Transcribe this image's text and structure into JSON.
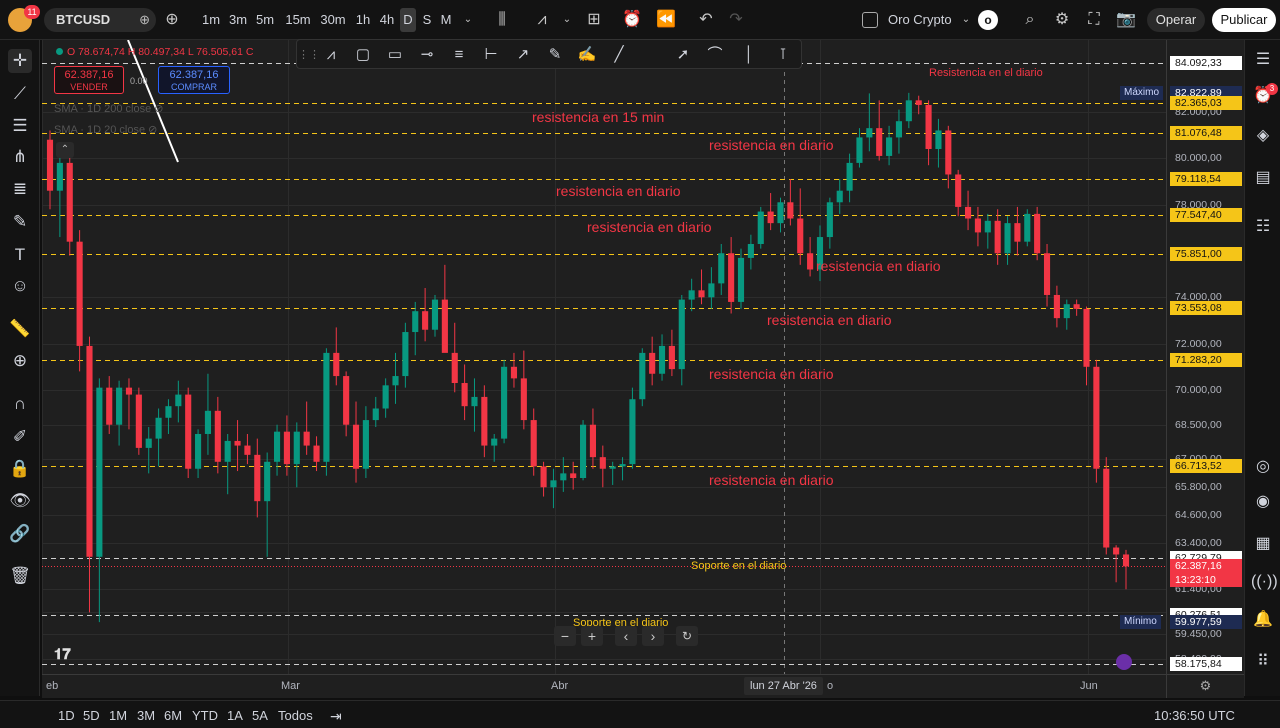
{
  "topbar": {
    "symbol": "BTCUSD",
    "notif_badge": "11",
    "intervals": [
      "1m",
      "3m",
      "5m",
      "15m",
      "30m",
      "1h",
      "4h",
      "D",
      "S",
      "M"
    ],
    "active_interval": "D",
    "watchlist": "Oro Crypto",
    "avatar_letter": "o",
    "trade_label": "Operar",
    "publish_label": "Publicar"
  },
  "legend": {
    "ohlc_text": "O 78.674,74 H 80.497,34 L 76.505,61 C",
    "sell_price": "62.387,16",
    "sell_label": "VENDER",
    "spread": "0.00",
    "buy_price": "62.387,16",
    "buy_label": "COMPRAR",
    "indicators": [
      "SMA · 1D 200 close",
      "SMA · 1D 20 close"
    ]
  },
  "price_scale": {
    "ticks": [
      {
        "text": "82.000,00",
        "price": 82000
      },
      {
        "text": "80.000,00",
        "price": 80000
      },
      {
        "text": "78.000,00",
        "price": 78000
      },
      {
        "text": "74.000,00",
        "price": 74000
      },
      {
        "text": "72.000,00",
        "price": 72000
      },
      {
        "text": "70.000,00",
        "price": 70000
      },
      {
        "text": "68.500,00",
        "price": 68500
      },
      {
        "text": "67.000,00",
        "price": 67000
      },
      {
        "text": "65.800,00",
        "price": 65800
      },
      {
        "text": "64.600,00",
        "price": 64600
      },
      {
        "text": "63.400,00",
        "price": 63400
      },
      {
        "text": "61.400,00",
        "price": 61400
      },
      {
        "text": "60.400,00",
        "price": 60400
      },
      {
        "text": "59.450,00",
        "price": 59450
      },
      {
        "text": "58.400,00",
        "price": 58400
      }
    ],
    "level_labels": [
      {
        "text": "84.092,33",
        "price": 84092.33,
        "bg": "#ffffff",
        "fg": "#131313"
      },
      {
        "text": "82.822,89",
        "price": 82822.89,
        "bg": "#1e2b52",
        "fg": "#ffffff",
        "tag": "Máximo"
      },
      {
        "text": "82.365,03",
        "price": 82365.03,
        "bg": "#f5c518",
        "fg": "#131313"
      },
      {
        "text": "81.076,48",
        "price": 81076.48,
        "bg": "#f5c518",
        "fg": "#131313"
      },
      {
        "text": "79.118,54",
        "price": 79118.54,
        "bg": "#f5c518",
        "fg": "#131313"
      },
      {
        "text": "77.547,40",
        "price": 77547.4,
        "bg": "#f5c518",
        "fg": "#131313"
      },
      {
        "text": "75.851,00",
        "price": 75851.0,
        "bg": "#f5c518",
        "fg": "#131313"
      },
      {
        "text": "73.553,08",
        "price": 73553.08,
        "bg": "#f5c518",
        "fg": "#131313"
      },
      {
        "text": "71.283,20",
        "price": 71283.2,
        "bg": "#f5c518",
        "fg": "#131313"
      },
      {
        "text": "66.713,52",
        "price": 66713.52,
        "bg": "#f5c518",
        "fg": "#131313"
      },
      {
        "text": "62.729,79",
        "price": 62729.79,
        "bg": "#ffffff",
        "fg": "#131313"
      },
      {
        "text": "62.387,16",
        "price": 62387.16,
        "bg": "#f23645",
        "fg": "#ffffff",
        "sub": "13:23:10"
      },
      {
        "text": "60.276,51",
        "price": 60276.51,
        "bg": "#ffffff",
        "fg": "#131313"
      },
      {
        "text": "59.977,59",
        "price": 59977.59,
        "bg": "#1e2b52",
        "fg": "#ffffff",
        "tag": "Mínimo"
      },
      {
        "text": "58.175,84",
        "price": 58175.84,
        "bg": "#ffffff",
        "fg": "#131313"
      }
    ]
  },
  "annotations": [
    {
      "text": "Resistencia en el diario",
      "kind": "red-small",
      "price": 84092.33,
      "at": "right"
    },
    {
      "text": "resistencia en 15 min",
      "kind": "red",
      "price": 82365.03,
      "at": "left"
    },
    {
      "text": "resistencia en diario",
      "kind": "red",
      "price": 81076.48,
      "at": "mid1"
    },
    {
      "text": "resistencia en diario",
      "kind": "red",
      "price": 79118.54,
      "at": "left2"
    },
    {
      "text": "resistencia en diario",
      "kind": "red",
      "price": 77547.4,
      "at": "left3"
    },
    {
      "text": "resistencia en diario",
      "kind": "red",
      "price": 75851.0,
      "at": "mid2"
    },
    {
      "text": "resistencia en diario",
      "kind": "red",
      "price": 73553.08,
      "at": "mid3"
    },
    {
      "text": "resistencia en diario",
      "kind": "red",
      "price": 71283.2,
      "at": "mid4"
    },
    {
      "text": "resistencia en diario",
      "kind": "red",
      "price": 66713.52,
      "at": "mid4"
    },
    {
      "text": "Soporte en el diario",
      "kind": "yellow",
      "price": 62729.79,
      "at": "mid5"
    },
    {
      "text": "Soporte en el diario",
      "kind": "yellow",
      "price": 60276.51,
      "at": "mid6"
    }
  ],
  "time_scale": {
    "labels": [
      "eb",
      "Mar",
      "Abr",
      "o",
      "Jun"
    ],
    "crosshair_label": "lun 27 Abr '26"
  },
  "colors": {
    "up": "#089981",
    "down": "#f23645",
    "level": "#f5c518",
    "red_text": "#f23645",
    "yellow_text": "#f5c518"
  },
  "chart_data": {
    "type": "candlestick",
    "symbol": "BTCUSD",
    "interval": "1D",
    "ylim": [
      58000,
      84500
    ],
    "candles": [
      [
        80800,
        81200,
        77800,
        78600
      ],
      [
        78600,
        80200,
        76600,
        79800
      ],
      [
        79800,
        80500,
        75800,
        76400
      ],
      [
        76400,
        76900,
        70800,
        71900
      ],
      [
        71900,
        72300,
        60400,
        62800
      ],
      [
        62800,
        70500,
        59977.59,
        70100
      ],
      [
        70100,
        70600,
        68100,
        68500
      ],
      [
        68500,
        70400,
        67600,
        70100
      ],
      [
        70100,
        70500,
        68300,
        69800
      ],
      [
        69800,
        70100,
        67200,
        67500
      ],
      [
        67500,
        68400,
        66400,
        67900
      ],
      [
        67900,
        69200,
        66700,
        68800
      ],
      [
        68800,
        69600,
        68100,
        69300
      ],
      [
        69300,
        70400,
        68600,
        69800
      ],
      [
        69800,
        70100,
        66200,
        66600
      ],
      [
        66600,
        68300,
        66200,
        68100
      ],
      [
        68100,
        70700,
        67200,
        69100
      ],
      [
        69100,
        69700,
        66400,
        66900
      ],
      [
        66900,
        68100,
        65500,
        67800
      ],
      [
        67800,
        68700,
        66500,
        67600
      ],
      [
        67600,
        68100,
        66800,
        67200
      ],
      [
        67200,
        67900,
        64500,
        65200
      ],
      [
        65200,
        67300,
        62800,
        66900
      ],
      [
        66900,
        68500,
        66300,
        68200
      ],
      [
        68200,
        68900,
        66300,
        66800
      ],
      [
        66800,
        68600,
        65800,
        68200
      ],
      [
        68200,
        69500,
        67200,
        67600
      ],
      [
        67600,
        68000,
        66500,
        66900
      ],
      [
        66900,
        71800,
        66300,
        71600
      ],
      [
        71600,
        72700,
        70200,
        70600
      ],
      [
        70600,
        70800,
        68000,
        68500
      ],
      [
        68500,
        69500,
        66000,
        66600
      ],
      [
        66600,
        69300,
        66200,
        68700
      ],
      [
        68700,
        69700,
        68400,
        69200
      ],
      [
        69200,
        70500,
        68800,
        70200
      ],
      [
        70200,
        71600,
        69400,
        70600
      ],
      [
        70600,
        72900,
        70100,
        72500
      ],
      [
        72500,
        73800,
        71500,
        73400
      ],
      [
        73400,
        74400,
        72100,
        72600
      ],
      [
        72600,
        74100,
        72300,
        73900
      ],
      [
        73900,
        75400,
        73700,
        71600
      ],
      [
        71600,
        72900,
        69900,
        70300
      ],
      [
        70300,
        71100,
        68700,
        69300
      ],
      [
        69300,
        70500,
        68200,
        69700
      ],
      [
        69700,
        70200,
        67100,
        67600
      ],
      [
        67600,
        68100,
        66900,
        67900
      ],
      [
        67900,
        71300,
        67700,
        71000
      ],
      [
        71000,
        71600,
        70100,
        70500
      ],
      [
        70500,
        71700,
        68300,
        68700
      ],
      [
        68700,
        69200,
        66300,
        66700
      ],
      [
        66700,
        66900,
        65400,
        65800
      ],
      [
        65800,
        66600,
        64900,
        66100
      ],
      [
        66100,
        67100,
        65600,
        66400
      ],
      [
        66400,
        66900,
        65700,
        66200
      ],
      [
        66200,
        68700,
        66100,
        68500
      ],
      [
        68500,
        69200,
        66600,
        67100
      ],
      [
        67100,
        67600,
        65800,
        66600
      ],
      [
        66600,
        66900,
        65900,
        66700
      ],
      [
        66700,
        67100,
        66100,
        66800
      ],
      [
        66800,
        70100,
        66600,
        69600
      ],
      [
        69600,
        71800,
        69300,
        71600
      ],
      [
        71600,
        72300,
        70200,
        70700
      ],
      [
        70700,
        72400,
        70400,
        71900
      ],
      [
        71900,
        72600,
        70600,
        70900
      ],
      [
        70900,
        74100,
        70200,
        73900
      ],
      [
        73900,
        74800,
        73400,
        74300
      ],
      [
        74300,
        75200,
        73700,
        74000
      ],
      [
        74000,
        75300,
        73500,
        74600
      ],
      [
        74600,
        76300,
        74100,
        75900
      ],
      [
        75900,
        76600,
        73300,
        73800
      ],
      [
        73800,
        76100,
        73500,
        75700
      ],
      [
        75700,
        76700,
        75200,
        76300
      ],
      [
        76300,
        77900,
        76100,
        77700
      ],
      [
        77700,
        78500,
        76900,
        77200
      ],
      [
        77200,
        78300,
        76800,
        78100
      ],
      [
        78100,
        79100,
        77100,
        77400
      ],
      [
        77400,
        78700,
        75400,
        75900
      ],
      [
        75900,
        76600,
        74900,
        75200
      ],
      [
        75200,
        77100,
        74700,
        76600
      ],
      [
        76600,
        78300,
        76100,
        78100
      ],
      [
        78100,
        79100,
        77600,
        78600
      ],
      [
        78600,
        80200,
        78100,
        79800
      ],
      [
        79800,
        81300,
        79600,
        80900
      ],
      [
        80900,
        82800,
        80300,
        81300
      ],
      [
        81300,
        82500,
        79900,
        80100
      ],
      [
        80100,
        81400,
        79700,
        80900
      ],
      [
        80900,
        82100,
        80200,
        81600
      ],
      [
        81600,
        82822.89,
        81300,
        82500
      ],
      [
        82500,
        82700,
        81900,
        82300
      ],
      [
        82300,
        82500,
        79700,
        80400
      ],
      [
        80400,
        81700,
        79600,
        81200
      ],
      [
        81200,
        81400,
        78700,
        79300
      ],
      [
        79300,
        79500,
        77500,
        77900
      ],
      [
        77900,
        78600,
        76900,
        77400
      ],
      [
        77400,
        77900,
        76200,
        76800
      ],
      [
        76800,
        77600,
        76100,
        77300
      ],
      [
        77300,
        77800,
        75400,
        75900
      ],
      [
        75900,
        77500,
        75400,
        77200
      ],
      [
        77200,
        77900,
        75800,
        76400
      ],
      [
        76400,
        77800,
        76200,
        77600
      ],
      [
        77600,
        77900,
        75600,
        75900
      ],
      [
        75900,
        76300,
        73600,
        74100
      ],
      [
        74100,
        74500,
        72700,
        73100
      ],
      [
        73100,
        73900,
        72600,
        73700
      ],
      [
        73700,
        73900,
        73200,
        73500
      ],
      [
        73500,
        73600,
        70200,
        71000
      ],
      [
        71000,
        71300,
        66000,
        66600
      ],
      [
        66600,
        67100,
        62900,
        63200
      ],
      [
        63200,
        63300,
        61700,
        62900
      ],
      [
        62900,
        63100,
        61400,
        62387.16
      ]
    ],
    "levels": [
      84092.33,
      82365.03,
      81076.48,
      79118.54,
      77547.4,
      75851.0,
      73553.08,
      71283.2,
      66713.52,
      62729.79,
      60276.51,
      58175.84
    ],
    "max": 82822.89,
    "min": 59977.59,
    "last": 62387.16
  },
  "bottombar": {
    "ranges": [
      "1D",
      "5D",
      "1M",
      "3M",
      "6M",
      "YTD",
      "1A",
      "5A",
      "Todos"
    ],
    "clock": "10:36:50 UTC"
  },
  "rightbar": {
    "alerts_badge": "3"
  }
}
